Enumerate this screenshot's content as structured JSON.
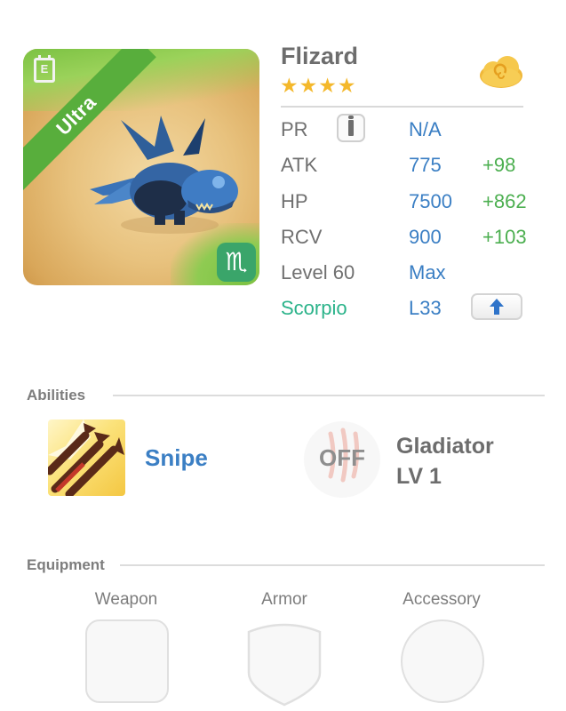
{
  "monster": {
    "name": "Flizard",
    "stars": "★★★★",
    "star_count": 4,
    "rarity_label": "Ultra",
    "type_badge": "E",
    "zodiac_glyph": "♏",
    "portrait_icon": "blue-dragon-creature",
    "element_icon": "cloud-icon"
  },
  "stats": [
    {
      "label": "PR",
      "value": "N/A",
      "bonus": ""
    },
    {
      "label": "ATK",
      "value": "775",
      "bonus": "+98"
    },
    {
      "label": "HP",
      "value": "7500",
      "bonus": "+862"
    },
    {
      "label": "RCV",
      "value": "900",
      "bonus": "+103"
    },
    {
      "label": "Level 60",
      "value": "Max",
      "bonus": ""
    },
    {
      "label": "Scorpio",
      "value": "L33",
      "bonus": ""
    }
  ],
  "abilities": {
    "title": "Abilities",
    "active": {
      "name": "Snipe",
      "icon": "arrows-icon"
    },
    "passive": {
      "status": "OFF",
      "name_line1": "Gladiator",
      "name_line2": "LV 1",
      "icon": "claw-icon"
    }
  },
  "equipment": {
    "title": "Equipment",
    "slots": [
      {
        "label": "Weapon",
        "shape": "rounded-square"
      },
      {
        "label": "Armor",
        "shape": "shield"
      },
      {
        "label": "Accessory",
        "shape": "circle"
      }
    ]
  },
  "colors": {
    "value_blue": "#3b7fc4",
    "bonus_green": "#4caf50",
    "zodiac_teal": "#2bb38a",
    "ultra_green": "#58ae3c",
    "star_gold": "#f4b82b"
  }
}
